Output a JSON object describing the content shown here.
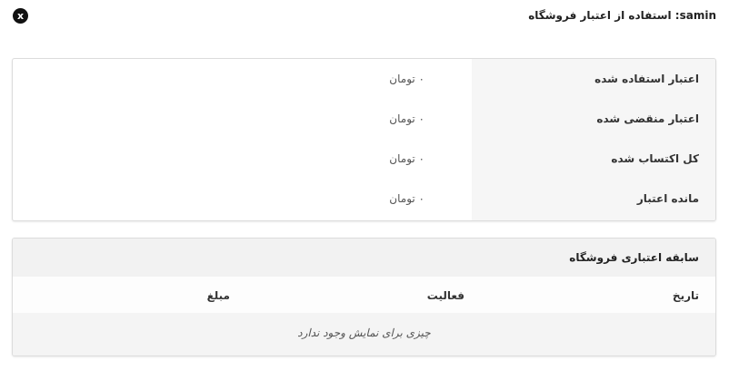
{
  "header": {
    "title": "samin: استفاده از اعتبار فروشگاه",
    "close_label": "x"
  },
  "summary": {
    "rows": [
      {
        "label": "اعتبار استفاده شده",
        "value": "۰ تومان"
      },
      {
        "label": "اعتبار منقضی شده",
        "value": "۰ تومان"
      },
      {
        "label": "کل اکتساب شده",
        "value": "۰ تومان"
      },
      {
        "label": "مانده اعتبار",
        "value": "۰ تومان"
      }
    ]
  },
  "history": {
    "title": "سابقه اعتباری فروشگاه",
    "columns": {
      "date": "تاریخ",
      "activity": "فعالیت",
      "amount": "مبلغ"
    },
    "empty_message": "چیزی برای نمایش وجود ندارد"
  }
}
